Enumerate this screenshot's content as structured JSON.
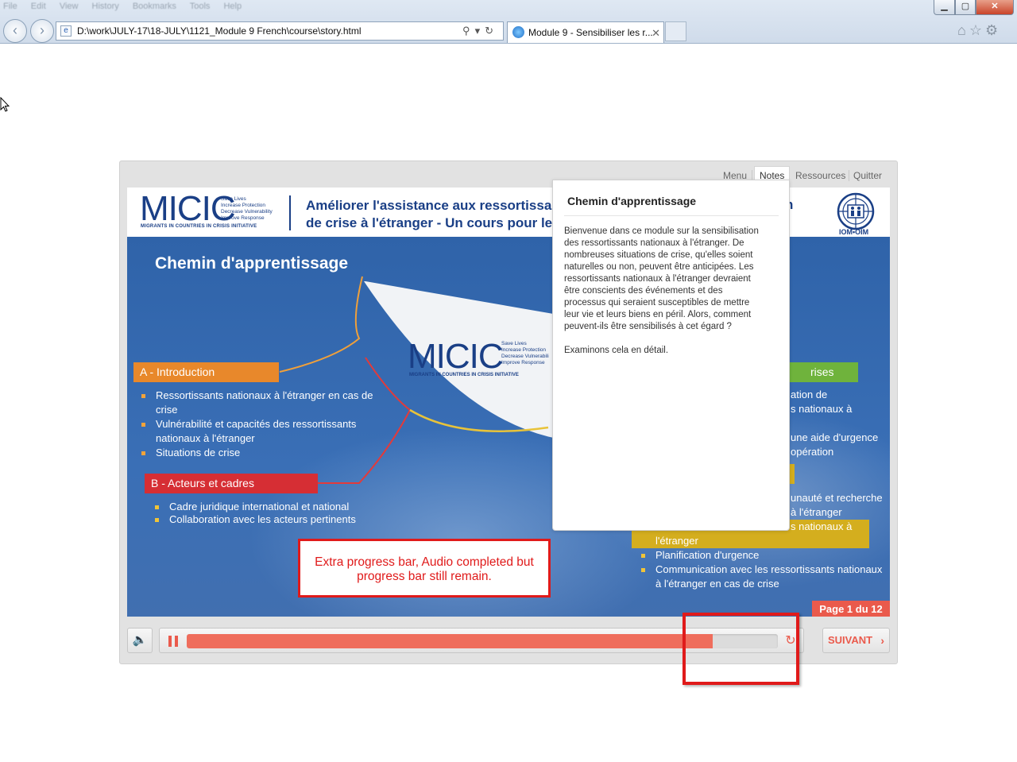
{
  "browser": {
    "menu": [
      "File",
      "Edit",
      "View",
      "History",
      "Bookmarks",
      "Tools",
      "Help"
    ],
    "address": "D:\\work\\JULY-17\\18-JULY\\1121_Module 9 French\\course\\story.html",
    "tab_title": "Module 9 - Sensibiliser les r...",
    "tab_close": "✕",
    "window_buttons": {
      "minimize": "▁",
      "maximize": "▢",
      "close": "✕"
    },
    "icons": {
      "back": "back-arrow-icon",
      "forward": "forward-arrow-icon",
      "search": "search-icon",
      "refresh": "refresh-icon",
      "home": "home-icon",
      "favorites": "star-icon",
      "settings": "gear-icon"
    }
  },
  "player": {
    "nav": {
      "menu": "Menu",
      "notes": "Notes",
      "resources": "Ressources",
      "quit": "Quitter"
    },
    "header": {
      "logo": "MICIC",
      "tagline": [
        "Save Lives",
        "Increase Protection",
        "Decrease Vulnerability",
        "Improve Response"
      ],
      "logo_sub": "MIGRANTS IN COUNTRIES IN CRISIS INITIATIVE",
      "course_title_line1": "Améliorer l'assistance aux ressortissan",
      "course_title_line2": "de crise à l'étranger - Un cours pour les",
      "course_title_tail": "n",
      "iom": "IOM•OIM"
    },
    "slide": {
      "title": "Chemin d'apprentissage",
      "disc_logo": "MICIC",
      "disc_tagline": [
        "Save Lives",
        "Increase Protection",
        "Decrease Vulnerabili",
        "Improve Response"
      ],
      "disc_sub": "MIGRANTS IN COUNTRIES IN CRISIS INITIATIVE",
      "section_a": {
        "label": "A - Introduction",
        "items": [
          "Ressortissants nationaux à l'étranger en cas de crise",
          "Vulnérabilité et capacités des ressortissants nationaux à l'étranger",
          "Situations de crise"
        ]
      },
      "section_b": {
        "label": "B - Acteurs et cadres",
        "items": [
          "Cadre juridique international et national",
          "Collaboration avec les acteurs pertinents"
        ]
      },
      "section_c_fragment": "rises",
      "right_fragments": [
        "ation de",
        "s nationaux à",
        "une aide d'urgence",
        "opération",
        "unauté et recherche",
        "à l'étranger",
        "s nationaux à",
        "l'étranger"
      ],
      "right_items": [
        "Planification d'urgence",
        "Communication avec les ressortissants nationaux à l'étranger en cas de crise"
      ],
      "page_indicator": "Page 1 du 12"
    },
    "notes": {
      "title": "Chemin d'apprentissage",
      "paragraph1": "Bienvenue dans ce module sur la sensibilisation des ressortissants nationaux à l'étranger. De nombreuses situations de crise, qu'elles soient naturelles ou non, peuvent être anticipées. Les ressortissants nationaux à l'étranger devraient être conscients des événements et des processus qui seraient susceptibles de mettre leur vie et leurs biens en péril. Alors, comment peuvent-ils être sensibilisés à cet égard ?",
      "paragraph2": "Examinons cela en détail."
    },
    "controls": {
      "next_label": "SUIVANT",
      "next_chevron": "›",
      "progress": 0.89,
      "volume_glyph": "🔈",
      "replay_glyph": "↻"
    }
  },
  "annotation": {
    "text": "Extra progress bar, Audio completed but progress bar still remain."
  },
  "colors": {
    "accent": "#ea5a4c",
    "brand_blue": "#1a3f86",
    "section_a": "#e8882b",
    "section_b": "#d62e34",
    "section_c": "#6fb33c",
    "section_d": "#d4ae1e",
    "annotation": "#e01a1a"
  }
}
